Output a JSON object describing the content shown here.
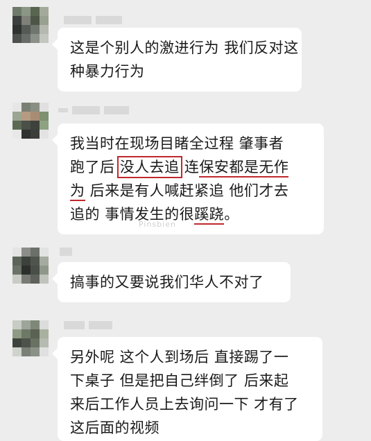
{
  "messages": [
    {
      "avatar": "blurred-avatar",
      "lines": [
        "这是个别人的激进行为 我们反对这",
        "种暴力行为"
      ]
    },
    {
      "avatar": "blurred-avatar",
      "line1": "我当时在现场目睹全过程  肇事者",
      "line2_a": "跑了后 ",
      "line2_b": "没人去追",
      "line2_c": " 连",
      "line2_d": "保安都是无作",
      "line3_a": "为",
      "line3_b": " 后来是有人喊赶紧追 他们才去",
      "line4_a": "追的  事情发生的很",
      "line4_b": "蹊跷",
      "line4_c": "。"
    },
    {
      "avatar": "blurred-avatar",
      "lines": [
        "搞事的又要说我们华人不对了"
      ]
    },
    {
      "avatar": "blurred-avatar",
      "lines": [
        "另外呢 这个人到场后 直接踢了一",
        "下桌子 但是把自己绊倒了 后来起",
        "来后工作人员上去询问一下 才有了",
        "这后面的视频"
      ]
    }
  ],
  "watermark": "Pinsbien",
  "colors": {
    "background": "#ededed",
    "bubble": "#ffffff",
    "highlight": "#c0272d"
  }
}
